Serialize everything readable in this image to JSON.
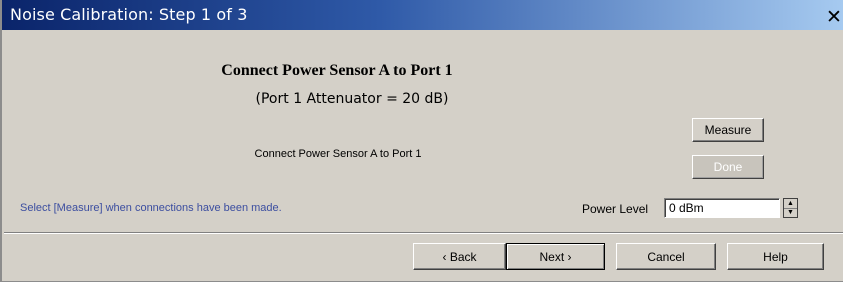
{
  "window": {
    "title": "Noise Calibration: Step 1 of 3",
    "close_glyph": "✕",
    "close_icon": "close-icon"
  },
  "main": {
    "heading": "Connect Power Sensor A to Port 1",
    "subheading": "(Port 1 Attenuator = 20 dB)",
    "instruction": "Connect Power Sensor A to Port 1",
    "status": "Select [Measure] when connections have been made."
  },
  "actions": {
    "measure_label": "Measure",
    "done_label": "Done"
  },
  "power": {
    "label": "Power Level",
    "value": "0 dBm",
    "spin_up": "▲",
    "spin_down": "▼"
  },
  "footer": {
    "back_label": "‹ Back",
    "next_label": "Next ›",
    "cancel_label": "Cancel",
    "help_label": "Help"
  },
  "colors": {
    "titlebar_start": "#0a246a",
    "titlebar_end": "#a6caf0",
    "dialog_bg": "#d4d0c8",
    "status_text": "#3c4ea0"
  }
}
